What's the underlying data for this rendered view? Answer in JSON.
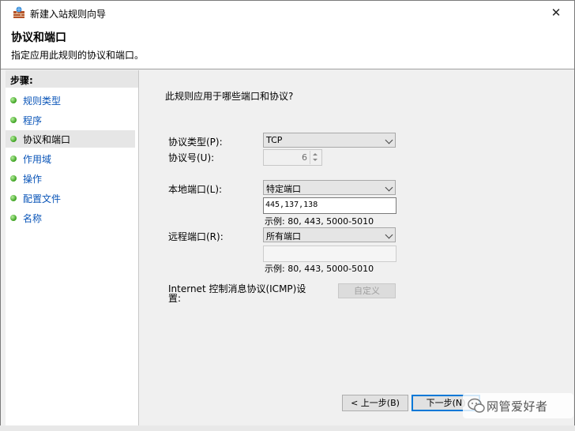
{
  "window": {
    "title": "新建入站规则向导",
    "close_glyph": "✕"
  },
  "header": {
    "title": "协议和端口",
    "subtitle": "指定应用此规则的协议和端口。"
  },
  "steps": {
    "heading": "步骤:",
    "items": [
      {
        "label": "规则类型"
      },
      {
        "label": "程序"
      },
      {
        "label": "协议和端口"
      },
      {
        "label": "作用域"
      },
      {
        "label": "操作"
      },
      {
        "label": "配置文件"
      },
      {
        "label": "名称"
      }
    ],
    "active_index": 2
  },
  "form": {
    "question": "此规则应用于哪些端口和协议?",
    "protocol_type_label": "协议类型(P):",
    "protocol_type_value": "TCP",
    "protocol_number_label": "协议号(U):",
    "protocol_number_value": "6",
    "local_port_label": "本地端口(L):",
    "local_port_value": "特定端口",
    "local_port_input": "445,137,138",
    "local_port_example": "示例: 80, 443, 5000-5010",
    "remote_port_label": "远程端口(R):",
    "remote_port_value": "所有端口",
    "remote_port_input": "",
    "remote_port_example": "示例: 80, 443, 5000-5010",
    "icmp_label_line1": "Internet 控制消息协议(ICMP)设",
    "icmp_label_line2": "置:",
    "customize_label": "自定义"
  },
  "buttons": {
    "back_label": "< 上一步(B)",
    "next_label": "下一步(N)"
  },
  "watermark": {
    "text": "网管爱好者"
  },
  "colors": {
    "link": "#0a55b8",
    "accent": "#0078d7",
    "step_dot": "#3aa01e"
  }
}
